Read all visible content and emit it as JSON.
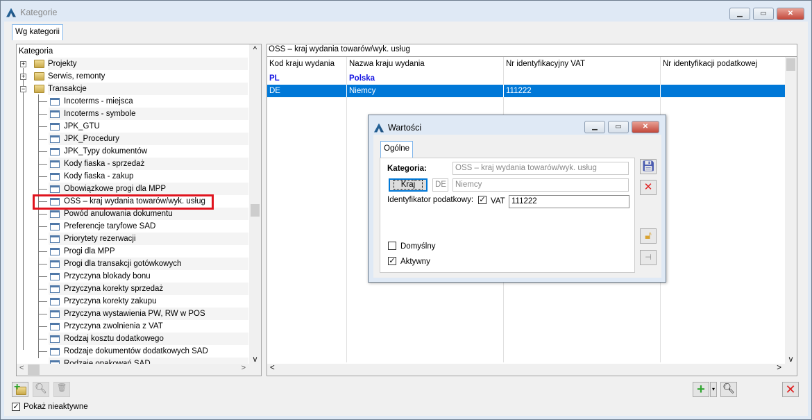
{
  "window": {
    "title": "Kategorie",
    "tab": "Wg kategorii"
  },
  "tree": {
    "header": "Kategoria",
    "folders": [
      "Projekty",
      "Serwis, remonty",
      "Transakcje"
    ],
    "items": [
      "Incoterms - miejsca",
      "Incoterms - symbole",
      "JPK_GTU",
      "JPK_Procedury",
      "JPK_Typy dokumentów",
      "Kody fiaska - sprzedaż",
      "Kody fiaska - zakup",
      "Obowiązkowe progi dla MPP",
      "OSS – kraj wydania towarów/wyk. usług",
      "Powód anulowania dokumentu",
      "Preferencje taryfowe SAD",
      "Priorytety rezerwacji",
      "Progi dla MPP",
      "Progi dla transakcji gotówkowych",
      "Przyczyna blokady bonu",
      "Przyczyna korekty sprzedaż",
      "Przyczyna korekty zakupu",
      "Przyczyna wystawienia PW, RW w POS",
      "Przyczyna zwolnienia z VAT",
      "Rodzaj kosztu dodatkowego",
      "Rodzaje dokumentów dodatkowych SAD",
      "Rodzaje opakowań SAD"
    ]
  },
  "grid": {
    "caption": "OSS – kraj wydania towarów/wyk. usług",
    "columns": [
      "Kod kraju wydania",
      "Nazwa kraju wydania",
      "Nr identyfikacyjny VAT",
      "Nr identyfikacji podatkowej"
    ],
    "rows": [
      [
        "PL",
        "Polska",
        "",
        ""
      ],
      [
        "DE",
        "Niemcy",
        "111222",
        ""
      ]
    ]
  },
  "dialog": {
    "title": "Wartości",
    "tab": "Ogólne",
    "kategoria_label": "Kategoria:",
    "kategoria_value": "OSS – kraj wydania towarów/wyk. usług",
    "kraj_button": "Kraj",
    "kraj_code": "DE",
    "kraj_name": "Niemcy",
    "id_label": "Identyfikator podatkowy:",
    "vat_label": "VAT",
    "vat_value": "111222",
    "domyslny": "Domyślny",
    "aktywny": "Aktywny"
  },
  "footer": {
    "show_inactive": "Pokaż nieaktywne"
  }
}
